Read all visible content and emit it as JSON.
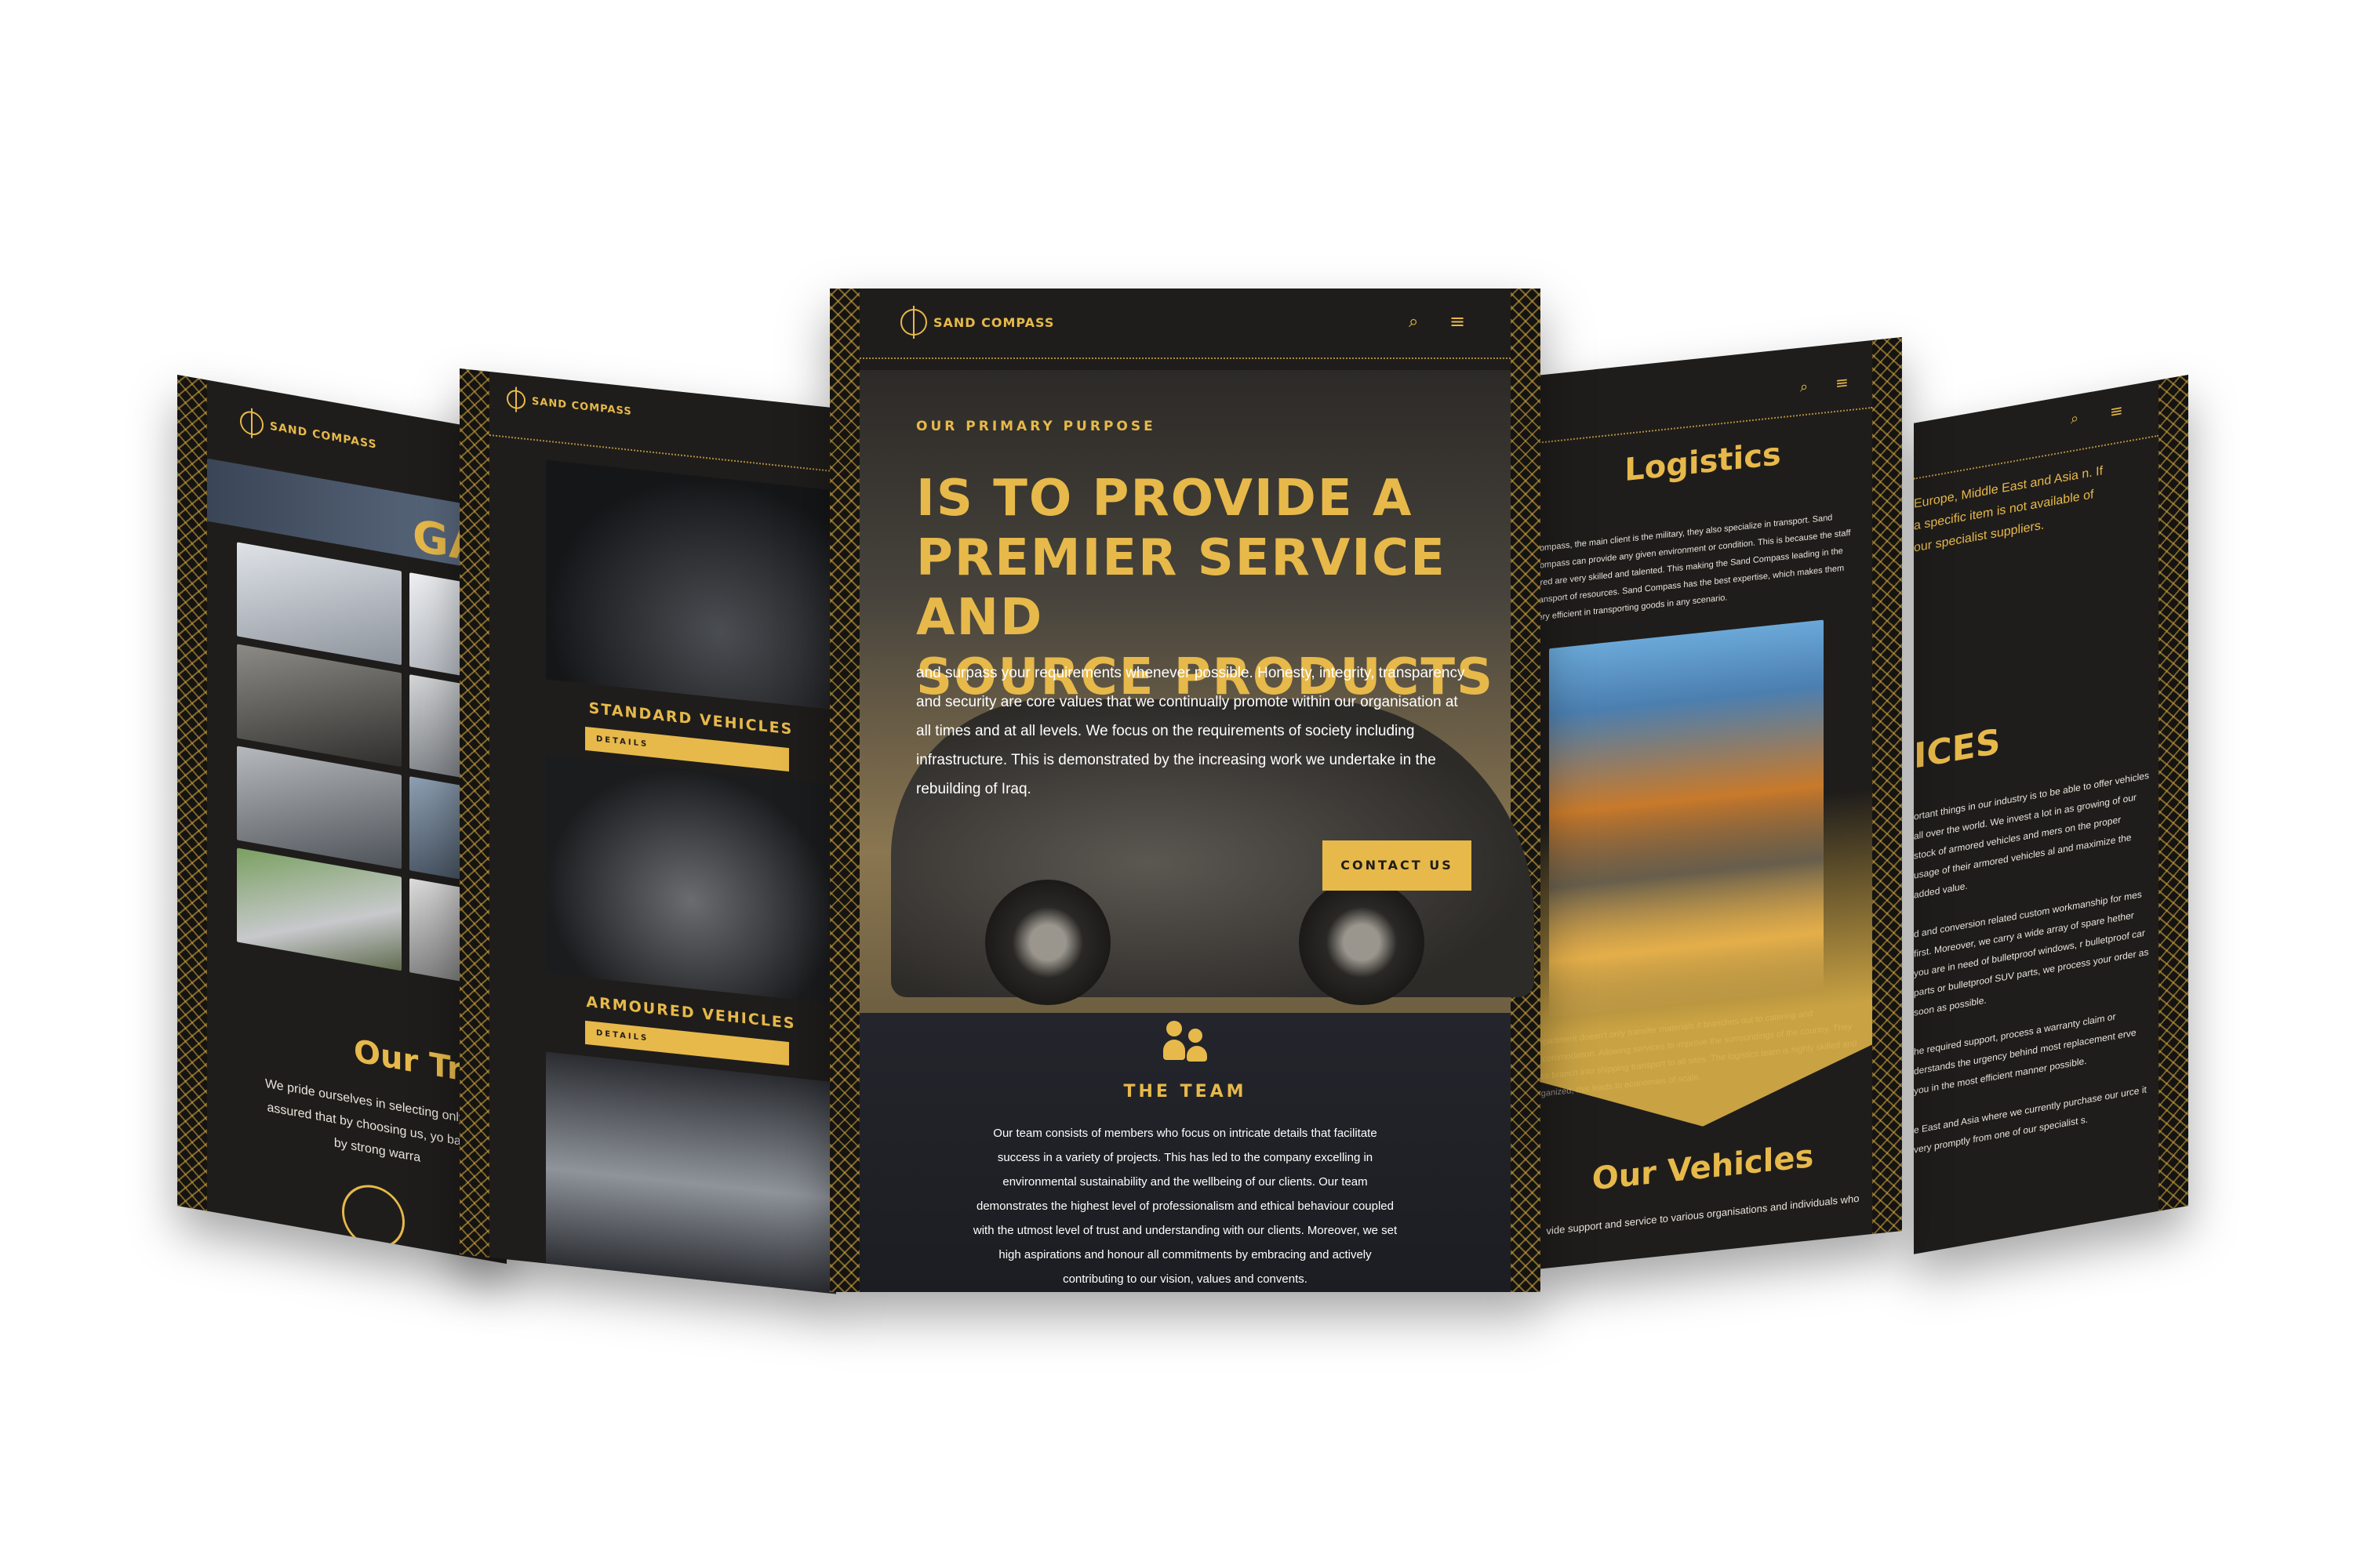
{
  "brand": {
    "name": "SAND COMPASS"
  },
  "colors": {
    "accent": "#e7b94a",
    "panel_bg": "#1f1d1b",
    "stage_bg": "#ffffff"
  },
  "panel_gallery": {
    "heading": "GAL",
    "trust_heading": "Our Trus",
    "trust_text": "We pride ourselves in selecting only rest assured that by choosing us, yo backed by strong warra"
  },
  "panel_vehicles": {
    "categories": [
      {
        "title": "STANDARD VEHICLES",
        "button": "DETAILS"
      },
      {
        "title": "ARMOURED VEHICLES",
        "button": "DETAILS"
      }
    ]
  },
  "panel_home": {
    "eyebrow": "OUR PRIMARY PURPOSE",
    "headline_lines": [
      "IS TO PROVIDE A",
      "PREMIER SERVICE AND",
      "SOURCE PRODUCTS"
    ],
    "body": "and surpass your requirements whenever possible. Honesty, integrity, transparency and security are core values that we continually promote within our organisation at all times and at all levels. We focus on the requirements of society including infrastructure. This is demonstrated by the increasing work we undertake in the rebuilding of Iraq.",
    "cta": "CONTACT US",
    "team_title": "THE TEAM",
    "team_text": "Our team consists of members who focus on intricate details that facilitate success in a variety of projects. This has led to the company excelling in environmental sustainability and the wellbeing of our clients. Our team demonstrates the highest level of professionalism and ethical behaviour coupled with the utmost level of trust and understanding with our clients. Moreover, we set high aspirations and honour all commitments by embracing and actively contributing to our vision, values and convents."
  },
  "panel_logistics": {
    "heading": "Logistics",
    "intro": "Compass, the main client is the military, they also specialize in transport. Sand Compass can provide any given environment or condition. This is because the staff hired are very skilled and talented. This making the Sand Compass leading in the transport of resources. Sand Compass has the best expertise, which makes them very efficient in transporting goods in any scenario.",
    "note": "department doesn't only transfer materials it branches out to catering and accommodation. Allowing services to improve the surroundings of the country. They also branch into shipping transport to all sites. The logistics team is highly skilled and organized, this leads to economies of scale.",
    "vehicles_heading": "Our Vehicles",
    "vehicles_text": "vide support and service to various organisations and individuals who"
  },
  "panel_services": {
    "top_text": "Europe, Middle East and Asia n. If a specific item is not available of our specialist suppliers.",
    "heading": "ICES",
    "paragraphs": [
      "ortant things in our industry is to be able to offer vehicles all over the world. We invest a lot in as growing of our stock of armored vehicles and mers on the proper usage of their armored vehicles al and maximize the added value.",
      "d and conversion related custom workmanship for mes first. Moreover, we carry a wide array of spare hether you are in need of bulletproof windows, r bulletproof car parts or bulletproof SUV parts, we process your order as soon as possible.",
      "he required support, process a warranty claim or derstands the urgency behind most replacement erve you in the most efficient manner possible.",
      "e East and Asia where we currently purchase our urce it very promptly from one of our specialist s."
    ]
  }
}
